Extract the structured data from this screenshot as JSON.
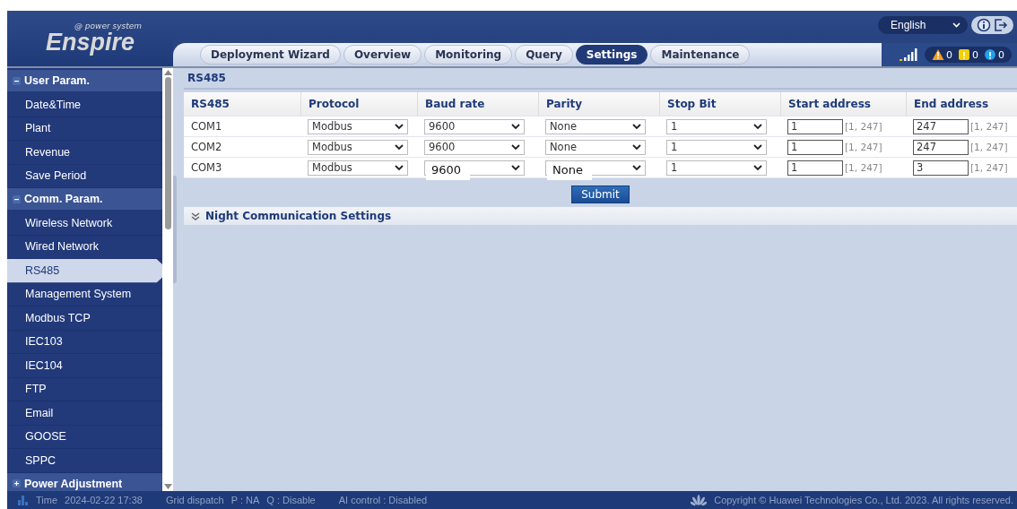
{
  "logo": {
    "tagline": "@ power system",
    "name": "Enspire"
  },
  "language": {
    "value": "English"
  },
  "tabs": [
    {
      "label": "Deployment Wizard",
      "selected": false
    },
    {
      "label": "Overview",
      "selected": false
    },
    {
      "label": "Monitoring",
      "selected": false
    },
    {
      "label": "Query",
      "selected": false
    },
    {
      "label": "Settings",
      "selected": true
    },
    {
      "label": "Maintenance",
      "selected": false
    }
  ],
  "alarms": [
    {
      "kind": "triangle",
      "color": "#f0a020",
      "count": "0"
    },
    {
      "kind": "square",
      "color": "#f5d000",
      "count": "0"
    },
    {
      "kind": "circle",
      "color": "#22a0e8",
      "count": "0"
    }
  ],
  "sidebar": {
    "groups": [
      {
        "label": "User Param.",
        "expanded": true,
        "items": [
          {
            "label": "Date&Time",
            "selected": false
          },
          {
            "label": "Plant",
            "selected": false
          },
          {
            "label": "Revenue",
            "selected": false
          },
          {
            "label": "Save Period",
            "selected": false
          }
        ]
      },
      {
        "label": "Comm. Param.",
        "expanded": true,
        "items": [
          {
            "label": "Wireless Network",
            "selected": false
          },
          {
            "label": "Wired Network",
            "selected": false
          },
          {
            "label": "RS485",
            "selected": true
          },
          {
            "label": "Management System",
            "selected": false
          },
          {
            "label": "Modbus TCP",
            "selected": false
          },
          {
            "label": "IEC103",
            "selected": false
          },
          {
            "label": "IEC104",
            "selected": false
          },
          {
            "label": "FTP",
            "selected": false
          },
          {
            "label": "Email",
            "selected": false
          },
          {
            "label": "GOOSE",
            "selected": false
          },
          {
            "label": "SPPC",
            "selected": false
          }
        ]
      },
      {
        "label": "Power Adjustment",
        "expanded": false
      }
    ]
  },
  "section": {
    "title": "RS485"
  },
  "table": {
    "columns": [
      "RS485",
      "Protocol",
      "Baud rate",
      "Parity",
      "Stop Bit",
      "Start address",
      "End address"
    ],
    "rows": [
      {
        "port": "COM1",
        "protocol": {
          "value": "Modbus"
        },
        "baud": {
          "value": "9600",
          "overlay": false
        },
        "parity": {
          "value": "None",
          "overlay": false
        },
        "stop": {
          "value": "1"
        },
        "start": {
          "value": "1",
          "range": "[1, 247]"
        },
        "end": {
          "value": "247",
          "range": "[1, 247]"
        }
      },
      {
        "port": "COM2",
        "protocol": {
          "value": "Modbus"
        },
        "baud": {
          "value": "9600",
          "overlay": false
        },
        "parity": {
          "value": "None",
          "overlay": false
        },
        "stop": {
          "value": "1"
        },
        "start": {
          "value": "1",
          "range": "[1, 247]"
        },
        "end": {
          "value": "247",
          "range": "[1, 247]"
        }
      },
      {
        "port": "COM3",
        "protocol": {
          "value": "Modbus"
        },
        "baud": {
          "value": "9600",
          "overlay": true
        },
        "parity": {
          "value": "None",
          "overlay": true
        },
        "stop": {
          "value": "1"
        },
        "start": {
          "value": "1",
          "range": "[1, 247]"
        },
        "end": {
          "value": "3",
          "range": "[1, 247]"
        }
      }
    ]
  },
  "submit": "Submit",
  "night_section": {
    "title": "Night Communication Settings",
    "expanded": false
  },
  "status_bar": {
    "time_label": "Time",
    "time": "2024-02-22 17:38",
    "grid_dispatch": "Grid dispatch",
    "p": "P : NA",
    "q": "Q : Disable",
    "ai_control": "AI control : Disabled",
    "copyright": "Copyright © Huawei Technologies Co., Ltd. 2023. All rights reserved."
  }
}
